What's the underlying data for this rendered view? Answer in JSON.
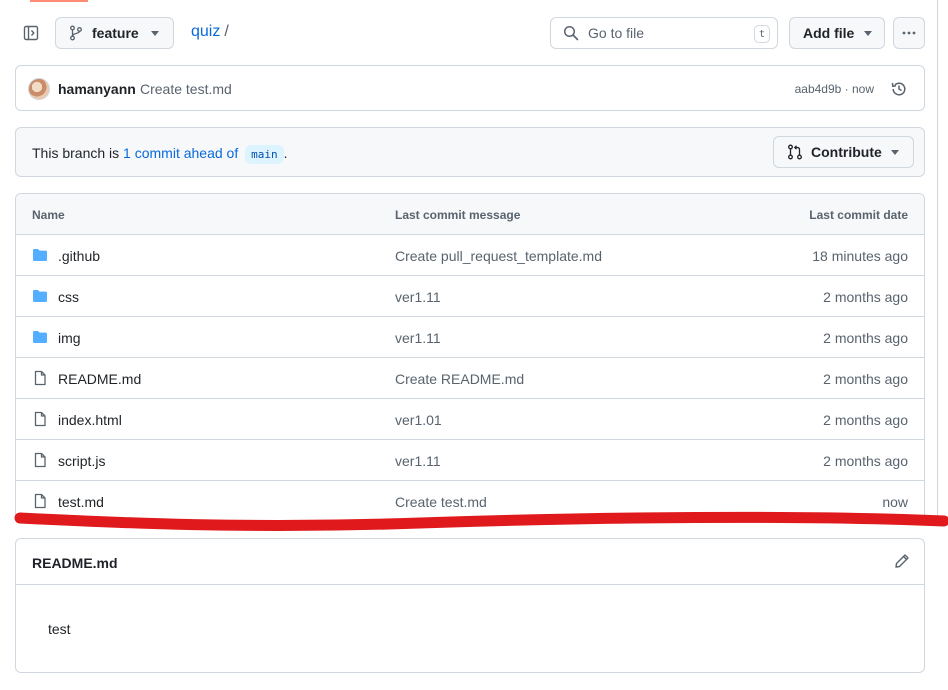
{
  "toolbar": {
    "branch": "feature",
    "repo": "quiz",
    "separator": "/",
    "search_placeholder": "Go to file",
    "search_shortcut": "t",
    "add_file": "Add file"
  },
  "latest_commit": {
    "author": "hamanyann",
    "message": "Create test.md",
    "meta": "aab4d9b · now"
  },
  "branch_status": {
    "prefix": "This branch is",
    "link": "1 commit ahead of",
    "base": "main",
    "suffix": ".",
    "contribute": "Contribute"
  },
  "files": {
    "headers": {
      "name": "Name",
      "message": "Last commit message",
      "date": "Last commit date"
    },
    "rows": [
      {
        "name": ".github",
        "message": "Create pull_request_template.md",
        "date": "18 minutes ago",
        "icon": "folder-icon"
      },
      {
        "name": "css",
        "message": "ver1.11",
        "date": "2 months ago",
        "icon": "folder-icon"
      },
      {
        "name": "img",
        "message": "ver1.11",
        "date": "2 months ago",
        "icon": "folder-icon"
      },
      {
        "name": "README.md",
        "message": "Create README.md",
        "date": "2 months ago",
        "icon": "file-icon"
      },
      {
        "name": "index.html",
        "message": "ver1.01",
        "date": "2 months ago",
        "icon": "file-icon"
      },
      {
        "name": "script.js",
        "message": "ver1.11",
        "date": "2 months ago",
        "icon": "file-icon"
      },
      {
        "name": "test.md",
        "message": "Create test.md",
        "date": "now",
        "icon": "file-icon"
      }
    ]
  },
  "readme": {
    "title": "README.md",
    "body": "test"
  },
  "colors": {
    "link": "#0969da",
    "folder": "#54aeff",
    "annotation": "#e0191c"
  }
}
